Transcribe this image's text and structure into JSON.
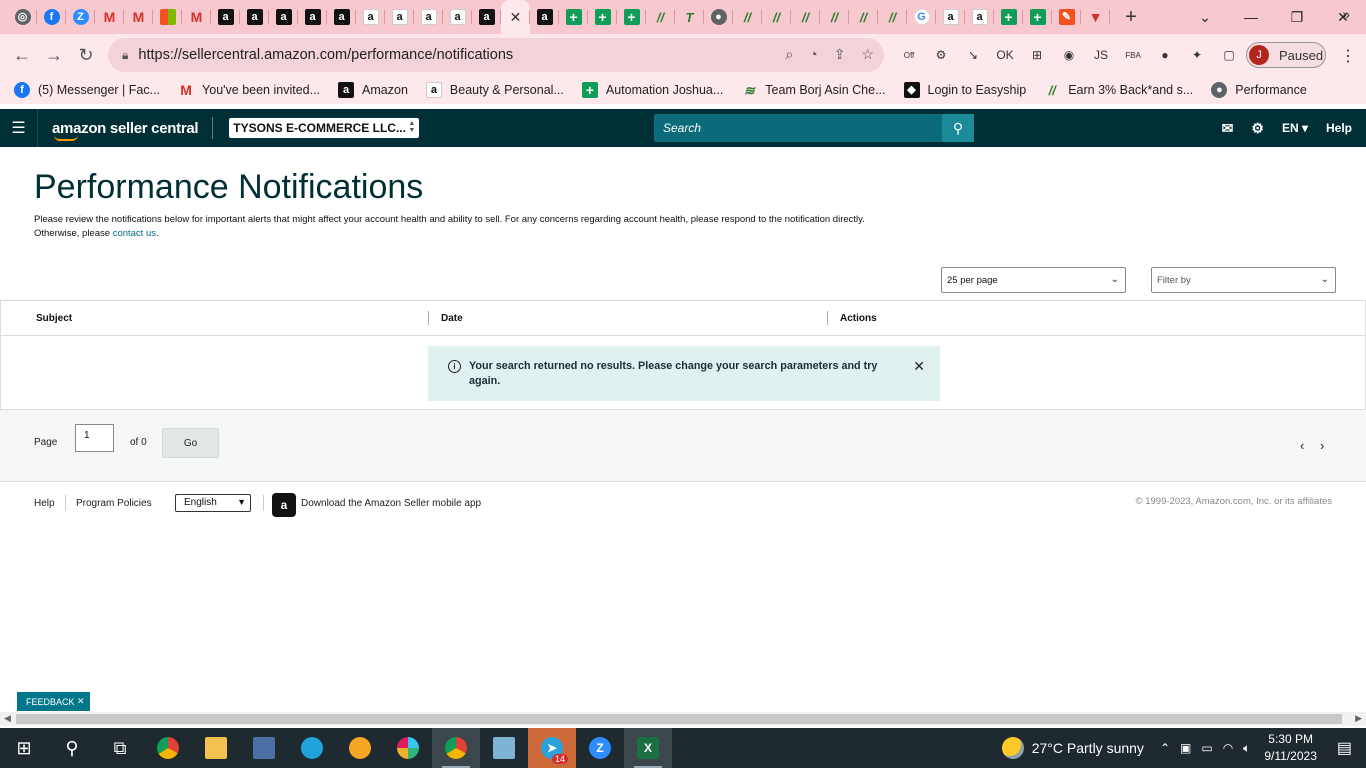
{
  "browser": {
    "tabs": [
      {
        "icon": "chrome-icon",
        "glyph": "◎",
        "cls": "gray"
      },
      {
        "icon": "facebook-icon",
        "glyph": "f",
        "cls": "fb"
      },
      {
        "icon": "zoom-icon",
        "glyph": "Z",
        "cls": "z"
      },
      {
        "icon": "gmail-icon",
        "glyph": "M",
        "cls": "gm"
      },
      {
        "icon": "gmail-icon",
        "glyph": "M",
        "cls": "gm"
      },
      {
        "icon": "microsoft-icon",
        "glyph": "",
        "cls": "ms"
      },
      {
        "icon": "gmail-icon",
        "glyph": "M",
        "cls": "gm"
      },
      {
        "icon": "amazon-icon",
        "glyph": "a",
        "cls": "amz"
      },
      {
        "icon": "amazon-icon",
        "glyph": "a",
        "cls": "amz"
      },
      {
        "icon": "amazon-icon",
        "glyph": "a",
        "cls": "amz"
      },
      {
        "icon": "amazon-icon",
        "glyph": "a",
        "cls": "amz"
      },
      {
        "icon": "amazon-icon",
        "glyph": "a",
        "cls": "amz"
      },
      {
        "icon": "amazon-smile-icon",
        "glyph": "a",
        "cls": "amzw"
      },
      {
        "icon": "amazon-smile-icon",
        "glyph": "a",
        "cls": "amzw"
      },
      {
        "icon": "amazon-smile-icon",
        "glyph": "a",
        "cls": "amzw"
      },
      {
        "icon": "amazon-smile-icon",
        "glyph": "a",
        "cls": "amzw"
      },
      {
        "icon": "amazon-icon",
        "glyph": "a",
        "cls": "amz"
      },
      {
        "icon": "close-icon",
        "glyph": "✕",
        "cls": "active"
      },
      {
        "icon": "amazon-icon",
        "glyph": "a",
        "cls": "amz"
      },
      {
        "icon": "sheets-plus-icon",
        "glyph": "+",
        "cls": "plus"
      },
      {
        "icon": "sheets-plus-icon",
        "glyph": "+",
        "cls": "plus"
      },
      {
        "icon": "sheets-plus-icon",
        "glyph": "+",
        "cls": "plus"
      },
      {
        "icon": "automation-icon",
        "glyph": "//",
        "cls": "ah"
      },
      {
        "icon": "team-icon",
        "glyph": "T",
        "cls": "ah"
      },
      {
        "icon": "globe-icon",
        "glyph": "●",
        "cls": "gray"
      },
      {
        "icon": "automation-icon",
        "glyph": "//",
        "cls": "ah"
      },
      {
        "icon": "automation-icon",
        "glyph": "//",
        "cls": "ah"
      },
      {
        "icon": "automation-icon",
        "glyph": "//",
        "cls": "ah"
      },
      {
        "icon": "automation-icon",
        "glyph": "//",
        "cls": "ah"
      },
      {
        "icon": "automation-icon",
        "glyph": "//",
        "cls": "ah"
      },
      {
        "icon": "automation-icon",
        "glyph": "//",
        "cls": "ah"
      },
      {
        "icon": "google-icon",
        "glyph": "G",
        "cls": "g"
      },
      {
        "icon": "amazon-smile-icon",
        "glyph": "a",
        "cls": "amzw"
      },
      {
        "icon": "amazon-smile-icon",
        "glyph": "a",
        "cls": "amzw"
      },
      {
        "icon": "sheets-plus-icon",
        "glyph": "+",
        "cls": "plus"
      },
      {
        "icon": "sheets-plus-icon",
        "glyph": "+",
        "cls": "plus"
      },
      {
        "icon": "pencil-icon",
        "glyph": "✎",
        "cls": "ls"
      },
      {
        "icon": "triangle-icon",
        "glyph": "▼",
        "cls": "tri"
      }
    ],
    "url": "https://sellercentral.amazon.com/performance/notifications",
    "profile_initial": "J",
    "profile_status": "Paused",
    "extensions": [
      "Off",
      "⚙",
      "↘",
      "OK",
      "⊞",
      "◉",
      "JS",
      "FBA",
      "●",
      "✦",
      "▢"
    ],
    "bookmarks": [
      {
        "icon": "facebook-icon",
        "glyph": "f",
        "cls": "fb",
        "label": "(5) Messenger | Fac..."
      },
      {
        "icon": "gmail-icon",
        "glyph": "M",
        "cls": "gm",
        "label": "You've been invited..."
      },
      {
        "icon": "amazon-icon",
        "glyph": "a",
        "cls": "amz",
        "label": "Amazon"
      },
      {
        "icon": "amazon-smile-icon",
        "glyph": "a",
        "cls": "amzw",
        "label": "Beauty & Personal..."
      },
      {
        "icon": "sheets-plus-icon",
        "glyph": "+",
        "cls": "plus",
        "label": "Automation Joshua..."
      },
      {
        "icon": "team-icon",
        "glyph": "≋",
        "cls": "ah",
        "label": "Team Borj Asin Che..."
      },
      {
        "icon": "easyship-icon",
        "glyph": "◆",
        "cls": "amz",
        "label": "Login to Easyship"
      },
      {
        "icon": "automation-icon",
        "glyph": "//",
        "cls": "ah",
        "label": "Earn 3% Back*and s..."
      },
      {
        "icon": "globe-icon",
        "glyph": "●",
        "cls": "gray",
        "label": "Performance"
      }
    ]
  },
  "header": {
    "brand": "amazon seller central",
    "account": "TYSONS E-COMMERCE LLC...",
    "search_placeholder": "Search",
    "language": "EN",
    "help": "Help"
  },
  "page": {
    "title": "Performance Notifications",
    "description": "Please review the notifications below for important alerts that might affect your account health and ability to sell. For any concerns regarding account health, please respond to the notification directly. Otherwise, please ",
    "contact_link": "contact us",
    "description_end": ".",
    "per_page": "25 per page",
    "filter_placeholder": "Filter by",
    "columns": [
      "Subject",
      "Date",
      "Actions"
    ],
    "alert": "Your search returned no results. Please change your search parameters and try again.",
    "pager": {
      "page_label": "Page",
      "page_value": "1",
      "of_label": "of 0",
      "go_label": "Go"
    }
  },
  "footer": {
    "help": "Help",
    "policies": "Program Policies",
    "language": "English",
    "app_text": "Download the Amazon Seller mobile app",
    "copyright": "© 1999-2023, Amazon.com, Inc. or its affiliates"
  },
  "feedback": "FEEDBACK",
  "taskbar": {
    "weather": "27°C  Partly sunny",
    "time": "5:30 PM",
    "date": "9/11/2023",
    "telegram_badge": "14"
  }
}
